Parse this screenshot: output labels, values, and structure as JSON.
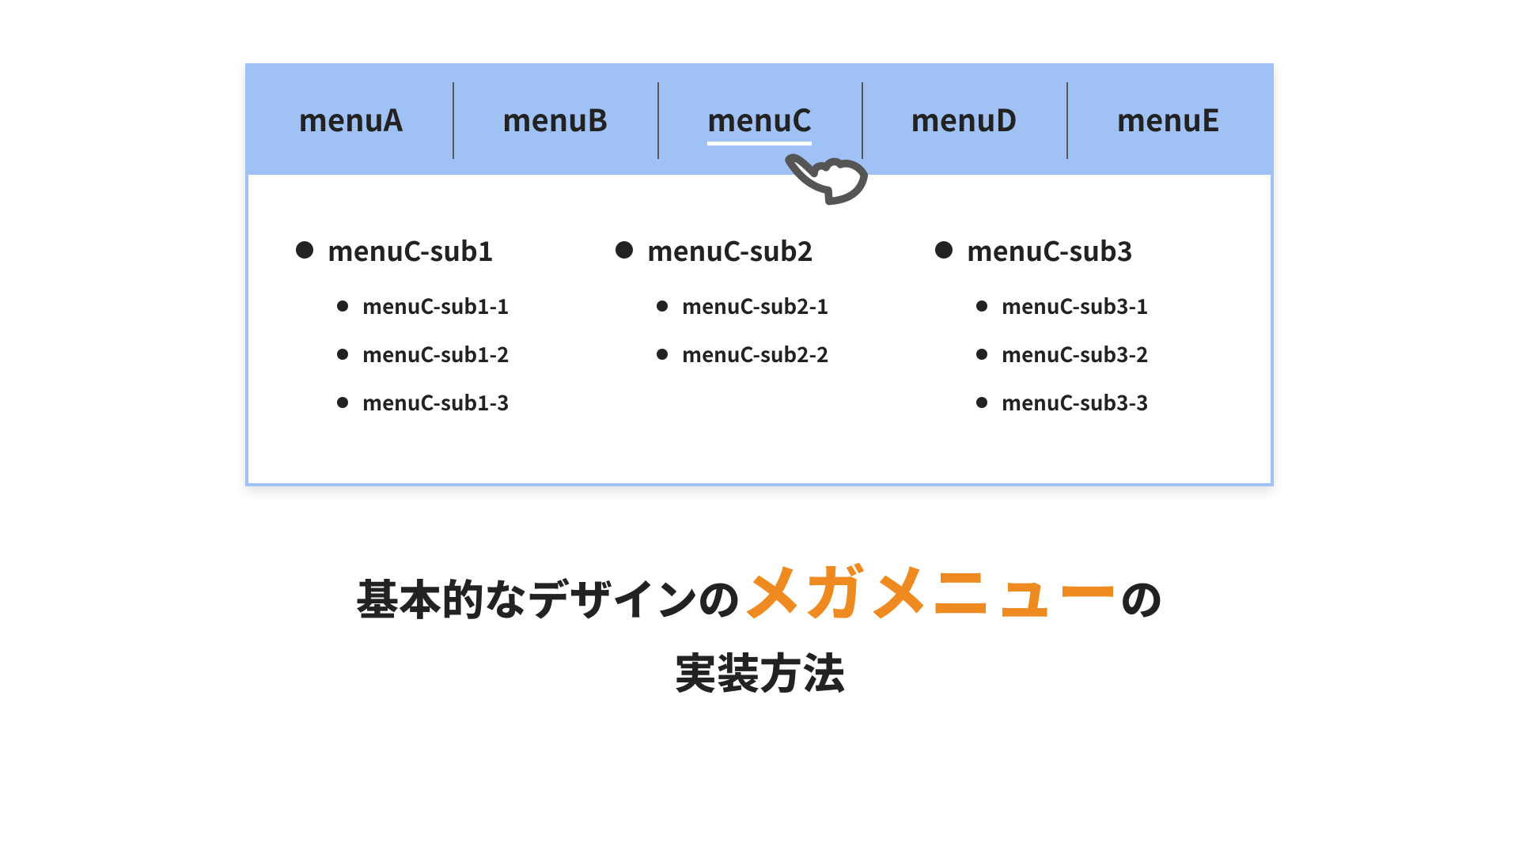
{
  "menubar": {
    "items": [
      {
        "label": "menuA",
        "active": false
      },
      {
        "label": "menuB",
        "active": false
      },
      {
        "label": "menuC",
        "active": true
      },
      {
        "label": "menuD",
        "active": false
      },
      {
        "label": "menuE",
        "active": false
      }
    ]
  },
  "dropdown": {
    "columns": [
      {
        "heading": "menuC-sub1",
        "items": [
          "menuC-sub1-1",
          "menuC-sub1-2",
          "menuC-sub1-3"
        ]
      },
      {
        "heading": "menuC-sub2",
        "items": [
          "menuC-sub2-1",
          "menuC-sub2-2"
        ]
      },
      {
        "heading": "menuC-sub3",
        "items": [
          "menuC-sub3-1",
          "menuC-sub3-2",
          "menuC-sub3-3"
        ]
      }
    ]
  },
  "caption": {
    "pre": "基本的なデザインの",
    "accent": "メガメニュー",
    "post": "の",
    "line2": "実装方法"
  },
  "colors": {
    "menubar_bg": "#9fc1f4",
    "accent_text": "#ee8a1f"
  }
}
